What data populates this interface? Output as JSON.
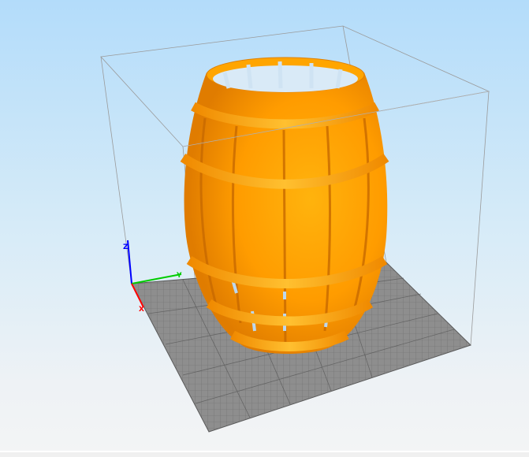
{
  "viewer": {
    "model_color": "#ff9c00",
    "plate_color": "#8e8e8e",
    "axes": {
      "x_label": "X",
      "y_label": "Y",
      "z_label": "Z",
      "x_color": "#ff0000",
      "y_color": "#00cc00",
      "z_color": "#0000ff"
    }
  }
}
